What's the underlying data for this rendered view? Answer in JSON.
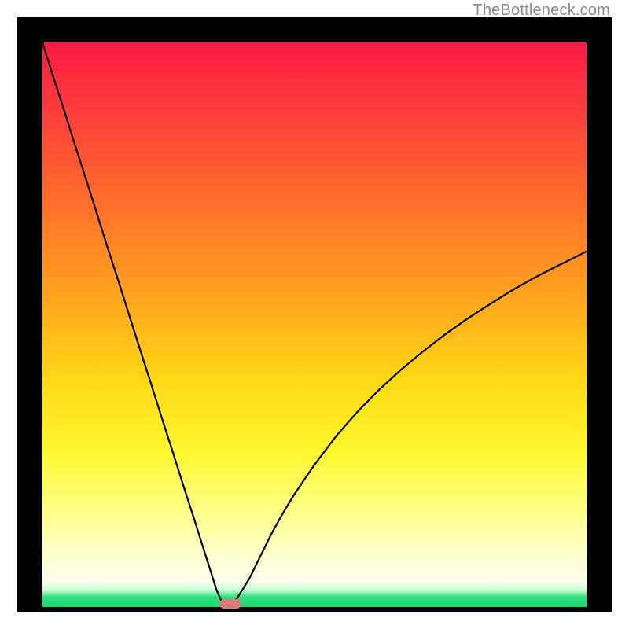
{
  "watermark": {
    "text": "TheBottleneck.com"
  },
  "colors": {
    "frame": "#000000",
    "gradient_stops": [
      {
        "pct": 0,
        "hex": "#fb1a43"
      },
      {
        "pct": 12,
        "hex": "#fd3d3c"
      },
      {
        "pct": 26,
        "hex": "#ff672d"
      },
      {
        "pct": 44,
        "hex": "#ffa11f"
      },
      {
        "pct": 60,
        "hex": "#ffd916"
      },
      {
        "pct": 72,
        "hex": "#fff62c"
      },
      {
        "pct": 82,
        "hex": "#ffff80"
      },
      {
        "pct": 90,
        "hex": "#ffffc8"
      },
      {
        "pct": 95.5,
        "hex": "#fdffee"
      },
      {
        "pct": 97,
        "hex": "#c8ffd5"
      },
      {
        "pct": 98.2,
        "hex": "#32e080"
      },
      {
        "pct": 100,
        "hex": "#17d86a"
      }
    ],
    "curve": "#000000",
    "marker": "#d97b7e",
    "watermark": "#8b8b8b"
  },
  "chart_data": {
    "type": "line",
    "title": "",
    "xlabel": "",
    "ylabel": "",
    "xlim": [
      0,
      100
    ],
    "ylim": [
      0,
      100
    ],
    "x": [
      0,
      2,
      4,
      6,
      8,
      10,
      12,
      14,
      16,
      18,
      20,
      22,
      24,
      26,
      28,
      30,
      31,
      32,
      33,
      34,
      35,
      36,
      38,
      40,
      42,
      44,
      46,
      48,
      50,
      54,
      58,
      62,
      66,
      70,
      74,
      78,
      82,
      86,
      90,
      94,
      98,
      100
    ],
    "values": [
      100,
      93.9,
      87.9,
      81.8,
      75.8,
      69.7,
      63.6,
      57.6,
      51.5,
      45.4,
      39.4,
      33.3,
      27.3,
      21.2,
      15.2,
      9.1,
      6.1,
      3.0,
      0.8,
      0.6,
      0.6,
      1.9,
      5.0,
      8.9,
      12.8,
      16.3,
      19.5,
      22.4,
      25.2,
      30.3,
      34.7,
      38.6,
      42.1,
      45.3,
      48.3,
      51.0,
      53.5,
      55.9,
      58.1,
      60.1,
      62.0,
      63.0
    ],
    "marker": {
      "x_range": [
        32.5,
        36.5
      ],
      "y": 0.6
    },
    "note": "V-shaped bottleneck curve; minimum (optimal, green zone) near x≈34; background gradient encodes bottleneck severity from green (low, bottom) to red (high, top). Axes unlabeled."
  }
}
